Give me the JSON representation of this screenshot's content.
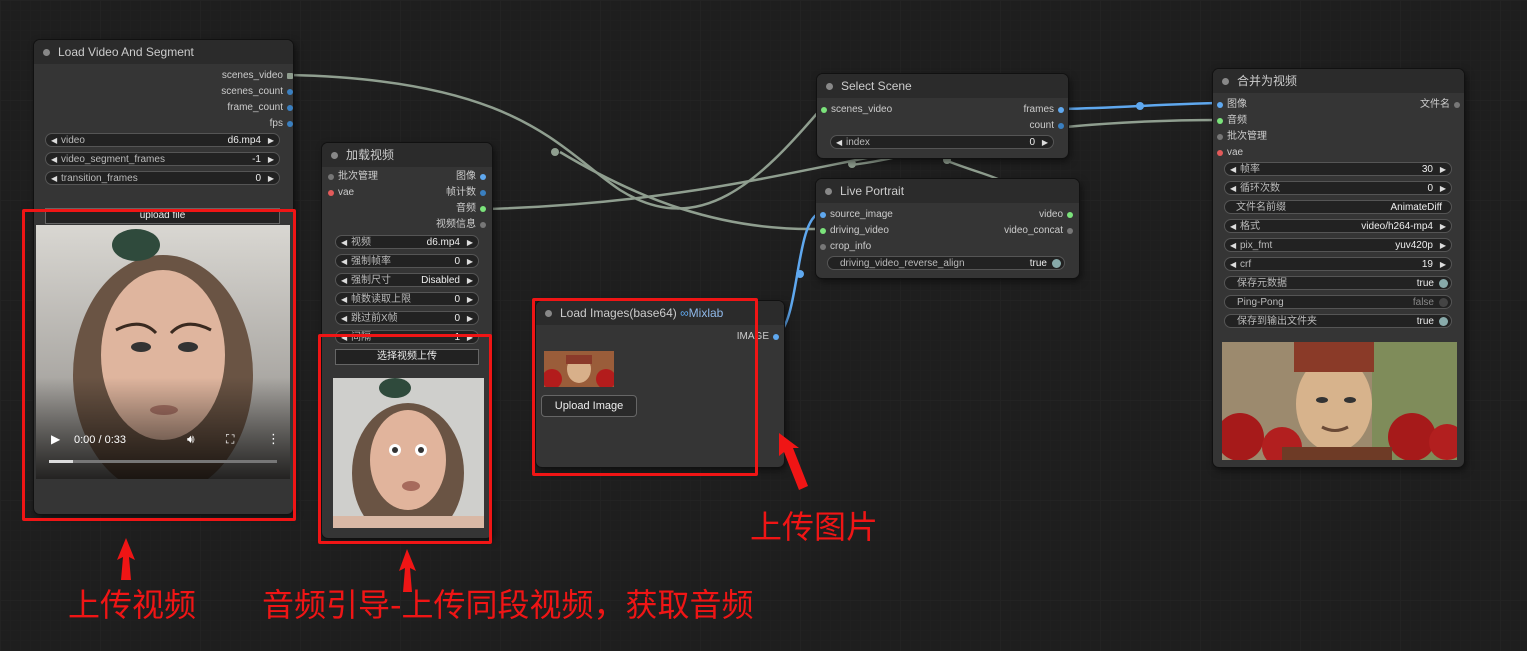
{
  "colors": {
    "accent_red": "#f01515",
    "link": "#8f9e8f",
    "link_blue": "#5fa8ef"
  },
  "nodes": {
    "load_video": {
      "title": "Load Video And Segment",
      "outputs": [
        "scenes_video",
        "scenes_count",
        "frame_count",
        "fps"
      ],
      "widgets": [
        {
          "label": "video",
          "value": "d6.mp4"
        },
        {
          "label": "video_segment_frames",
          "value": "-1"
        },
        {
          "label": "transition_frames",
          "value": "0"
        }
      ],
      "upload_label": "upload file",
      "player": {
        "time": "0:00 / 0:33"
      }
    },
    "load_video_cn": {
      "title": "加载视频",
      "inputs": [
        "批次管理",
        "vae"
      ],
      "outputs": [
        "图像",
        "帧计数",
        "音频",
        "视频信息"
      ],
      "widgets": [
        {
          "label": "视频",
          "value": "d6.mp4"
        },
        {
          "label": "强制帧率",
          "value": "0"
        },
        {
          "label": "强制尺寸",
          "value": "Disabled"
        },
        {
          "label": "帧数读取上限",
          "value": "0"
        },
        {
          "label": "跳过前X帧",
          "value": "0"
        },
        {
          "label": "间隔",
          "value": "1"
        }
      ],
      "upload_label": "选择视频上传"
    },
    "load_images": {
      "title": "Load Images(base64)",
      "badge": "Mixlab",
      "outputs": [
        "IMAGE"
      ],
      "upload_label": "Upload Image"
    },
    "select_scene": {
      "title": "Select Scene",
      "inputs": [
        "scenes_video"
      ],
      "outputs": [
        "frames",
        "count"
      ],
      "widgets": [
        {
          "label": "index",
          "value": "0"
        }
      ]
    },
    "live_portrait": {
      "title": "Live Portrait",
      "inputs": [
        "source_image",
        "driving_video",
        "crop_info"
      ],
      "outputs": [
        "video",
        "video_concat"
      ],
      "toggle": {
        "label": "driving_video_reverse_align",
        "value": "true"
      }
    },
    "combine": {
      "title": "合并为视频",
      "inputs": [
        "图像",
        "音频",
        "批次管理",
        "vae"
      ],
      "outputs": [
        "文件名"
      ],
      "widgets": [
        {
          "label": "帧率",
          "value": "30"
        },
        {
          "label": "循环次数",
          "value": "0"
        }
      ],
      "text_widget": {
        "label": "文件名前缀",
        "value": "AnimateDiff"
      },
      "widgets2": [
        {
          "label": "格式",
          "value": "video/h264-mp4"
        },
        {
          "label": "pix_fmt",
          "value": "yuv420p"
        },
        {
          "label": "crf",
          "value": "19"
        }
      ],
      "toggles": [
        {
          "label": "保存元数据",
          "value": "true"
        },
        {
          "label": "Ping-Pong",
          "value": "false"
        },
        {
          "label": "保存到输出文件夹",
          "value": "true"
        }
      ]
    }
  },
  "annotations": {
    "upload_video": "上传视频",
    "audio_guide": "音频引导-上传同段视频，获取音频",
    "upload_image": "上传图片"
  }
}
